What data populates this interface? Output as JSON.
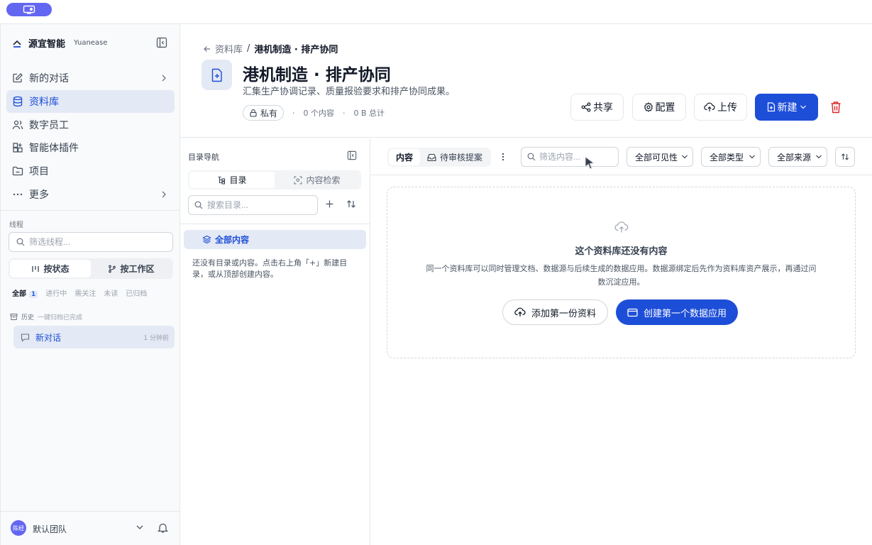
{
  "colors": {
    "accent": "#1d4ed8",
    "active_bg": "#e3e9f5",
    "danger": "#dc2626",
    "pill": "#6366f1"
  },
  "brand": {
    "name": "源宜智能",
    "sub": "Yuanease"
  },
  "nav": {
    "items": [
      {
        "label": "新的对话",
        "icon": "edit-icon"
      },
      {
        "label": "资料库",
        "icon": "database-icon"
      },
      {
        "label": "数字员工",
        "icon": "users-icon"
      },
      {
        "label": "智能体插件",
        "icon": "grid-plus-icon"
      },
      {
        "label": "项目",
        "icon": "folder-icon"
      },
      {
        "label": "更多",
        "icon": "more-icon"
      }
    ]
  },
  "threads": {
    "title": "线程",
    "filter_placeholder": "筛选线程...",
    "group_by_status": "按状态",
    "group_by_workspace": "按工作区",
    "tabs": [
      "全部",
      "进行中",
      "需关注",
      "未读",
      "已归档"
    ],
    "all_count": "1",
    "history_label": "历史",
    "history_note": "一键归档已完成",
    "items": [
      {
        "name": "新对话",
        "time": "1 分钟前"
      }
    ]
  },
  "footer": {
    "avatar": "陈经",
    "team": "默认团队"
  },
  "header": {
    "breadcrumb_parent": "资料库",
    "breadcrumb_sep": "/",
    "breadcrumb_current": "港机制造 · 排产协同",
    "title": "港机制造 · 排产协同",
    "description": "汇集生产协调记录、质量报验要求和排产协同成果。",
    "privacy": "私有",
    "content_count": "0 个内容",
    "total_size": "0 B 总计",
    "dot": "·"
  },
  "actions": {
    "share": "共享",
    "config": "配置",
    "upload": "上传",
    "new": "新建"
  },
  "directory": {
    "title": "目录导航",
    "tab_tree": "目录",
    "tab_search": "内容检索",
    "search_placeholder": "搜索目录...",
    "all_content": "全部内容",
    "empty_text": "还没有目录或内容。点击右上角「+」新建目录，或从顶部创建内容。"
  },
  "toolbar": {
    "tab_content": "内容",
    "tab_pending": "待审核提案",
    "filter_placeholder": "筛选内容...",
    "visibility": "全部可见性",
    "type": "全部类型",
    "source": "全部来源"
  },
  "empty": {
    "title": "这个资料库还没有内容",
    "description": "同一个资料库可以同时管理文档、数据源与后续生成的数据应用。数据源绑定后先作为资料库资产展示，再通过问数沉淀应用。",
    "add_button": "添加第一份资料",
    "create_button": "创建第一个数据应用"
  }
}
